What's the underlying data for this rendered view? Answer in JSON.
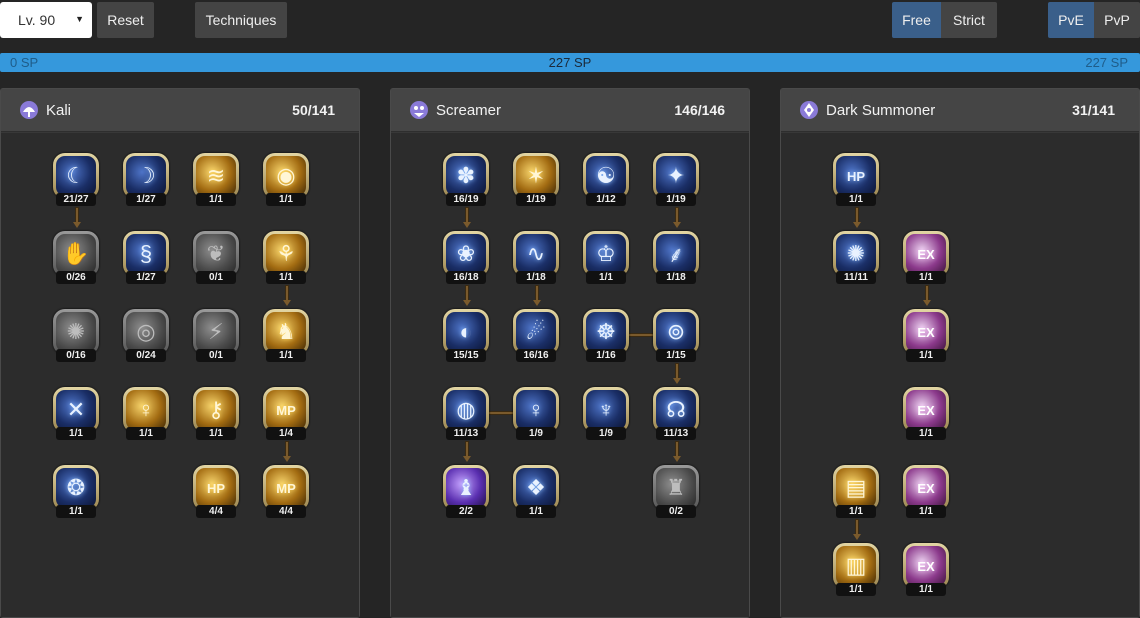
{
  "toolbar": {
    "level": "Lv. 90",
    "reset_label": "Reset",
    "techniques_label": "Techniques",
    "free_label": "Free",
    "strict_label": "Strict",
    "pve_label": "PvE",
    "pvp_label": "PvP"
  },
  "sp_bar": {
    "min": "0 SP",
    "current": "227 SP",
    "max": "227 SP"
  },
  "panels": [
    {
      "title": "Kali",
      "count": "50/141",
      "skills": [
        {
          "level": "21/27",
          "style": "blue",
          "glyph": "☾"
        },
        {
          "level": "1/27",
          "style": "blue",
          "glyph": "☽"
        },
        {
          "level": "1/1",
          "style": "gold",
          "glyph": "≋"
        },
        {
          "level": "1/1",
          "style": "gold",
          "glyph": "◉"
        },
        {
          "level": "0/26",
          "style": "locked",
          "glyph": "✋"
        },
        {
          "level": "1/27",
          "style": "blue",
          "glyph": "§"
        },
        {
          "level": "0/1",
          "style": "locked",
          "glyph": "❦"
        },
        {
          "level": "1/1",
          "style": "gold",
          "glyph": "⚘"
        },
        {
          "level": "0/16",
          "style": "locked",
          "glyph": "✺"
        },
        {
          "level": "0/24",
          "style": "locked",
          "glyph": "◎"
        },
        {
          "level": "0/1",
          "style": "locked",
          "glyph": "⚡"
        },
        {
          "level": "1/1",
          "style": "gold",
          "glyph": "♞"
        },
        {
          "level": "1/1",
          "style": "blue",
          "glyph": "✕"
        },
        {
          "level": "1/1",
          "style": "gold",
          "glyph": "♀"
        },
        {
          "level": "1/1",
          "style": "gold",
          "glyph": "⚷"
        },
        {
          "level": "1/4",
          "style": "gold",
          "glyph": "MP"
        },
        {
          "level": "1/1",
          "style": "blue",
          "glyph": "❂"
        },
        {
          "level": "4/4",
          "style": "gold",
          "glyph": "HP"
        },
        {
          "level": "4/4",
          "style": "gold",
          "glyph": "MP"
        }
      ]
    },
    {
      "title": "Screamer",
      "count": "146/146",
      "skills": [
        {
          "level": "16/19",
          "style": "blue",
          "glyph": "✽"
        },
        {
          "level": "1/19",
          "style": "gold",
          "glyph": "✶"
        },
        {
          "level": "1/12",
          "style": "blue",
          "glyph": "☯"
        },
        {
          "level": "1/19",
          "style": "blue",
          "glyph": "✦"
        },
        {
          "level": "16/18",
          "style": "blue",
          "glyph": "❀"
        },
        {
          "level": "1/18",
          "style": "blue",
          "glyph": "∿"
        },
        {
          "level": "1/1",
          "style": "blue",
          "glyph": "♔"
        },
        {
          "level": "1/18",
          "style": "blue",
          "glyph": "⸙"
        },
        {
          "level": "15/15",
          "style": "blue",
          "glyph": "◐"
        },
        {
          "level": "16/16",
          "style": "blue",
          "glyph": "☄"
        },
        {
          "level": "1/16",
          "style": "blue",
          "glyph": "☸"
        },
        {
          "level": "1/15",
          "style": "blue",
          "glyph": "⊚"
        },
        {
          "level": "11/13",
          "style": "blue",
          "glyph": "◍"
        },
        {
          "level": "1/9",
          "style": "blue",
          "glyph": "♀"
        },
        {
          "level": "1/9",
          "style": "blue",
          "glyph": "♆"
        },
        {
          "level": "11/13",
          "style": "blue",
          "glyph": "☊"
        },
        {
          "level": "2/2",
          "style": "purple",
          "glyph": "♝"
        },
        {
          "level": "1/1",
          "style": "blue",
          "glyph": "❖"
        },
        {
          "level": "0/2",
          "style": "locked",
          "glyph": "♜"
        }
      ]
    },
    {
      "title": "Dark Summoner",
      "count": "31/141",
      "skills": [
        {
          "level": "1/1",
          "style": "blue",
          "glyph": "HP"
        },
        {
          "level": "11/11",
          "style": "blue",
          "glyph": "✺"
        },
        {
          "level": "1/1",
          "style": "pink",
          "glyph": "EX"
        },
        {
          "level": "1/1",
          "style": "pink",
          "glyph": "EX"
        },
        {
          "level": "1/1",
          "style": "pink",
          "glyph": "EX"
        },
        {
          "level": "1/1",
          "style": "gold",
          "glyph": "▤"
        },
        {
          "level": "1/1",
          "style": "pink",
          "glyph": "EX"
        },
        {
          "level": "1/1",
          "style": "gold",
          "glyph": "▥"
        },
        {
          "level": "1/1",
          "style": "pink",
          "glyph": "EX"
        }
      ]
    }
  ]
}
